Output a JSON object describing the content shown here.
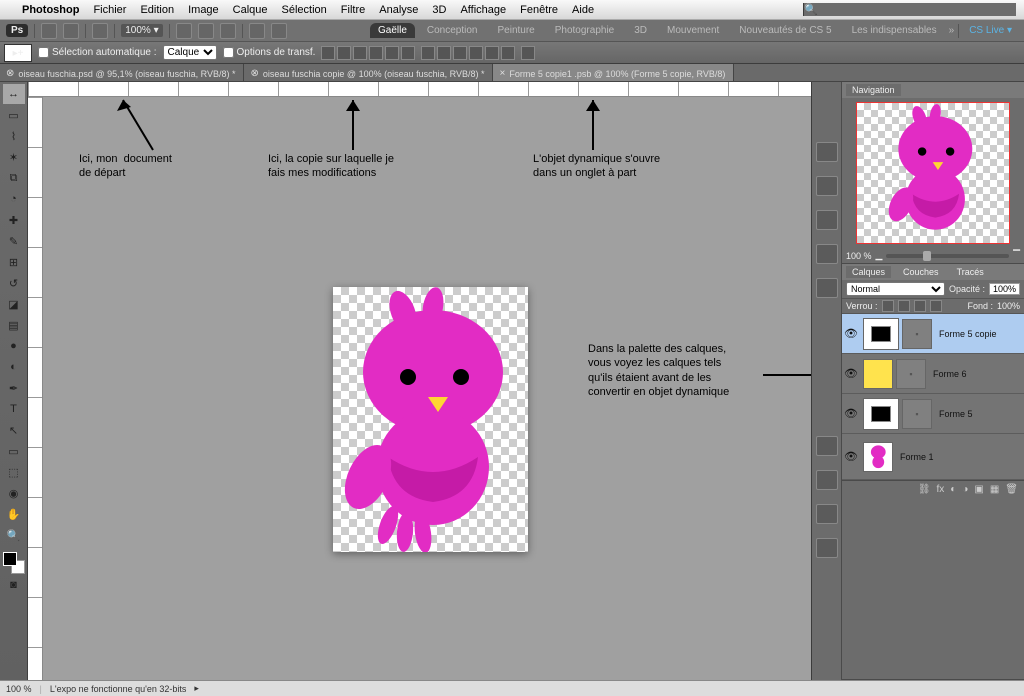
{
  "mac_menu": {
    "app": "Photoshop",
    "items": [
      "Fichier",
      "Edition",
      "Image",
      "Calque",
      "Sélection",
      "Filtre",
      "Analyse",
      "3D",
      "Affichage",
      "Fenêtre",
      "Aide"
    ]
  },
  "appbar": {
    "zoom": "100% ▾",
    "workspaces": [
      "Gaëlle",
      "Conception",
      "Peinture",
      "Photographie",
      "3D",
      "Mouvement",
      "Nouveautés de CS 5",
      "Les indispensables"
    ],
    "active_ws": 0,
    "cslive": "CS Live ▾"
  },
  "options": {
    "auto_select": "Sélection automatique :",
    "layer_select": "Calque",
    "transform": "Options de transf.",
    "tool_icon": "▸+"
  },
  "doc_tabs": [
    "oiseau fuschia.psd @ 95,1% (oiseau fuschia, RVB/8) *",
    "oiseau fuschia copie @ 100% (oiseau fuschia, RVB/8) *",
    "Forme 5 copie1 .psb @ 100% (Forme 5 copie, RVB/8)"
  ],
  "active_tab": 2,
  "annotations": {
    "a1": "Ici, mon  document\nde départ",
    "a2": "Ici, la copie sur laquelle je\nfais mes modifications",
    "a3": "L'objet dynamique s'ouvre\ndans un onglet à part",
    "a4": "Dans la palette des calques,\nvous voyez les calques tels\nqu'ils étaient avant de les\nconvertir en objet dynamique"
  },
  "panels": {
    "navigation": {
      "title": "Navigation",
      "zoom": "100 %"
    },
    "layers": {
      "tabs": [
        "Calques",
        "Couches",
        "Tracés"
      ],
      "blend": "Normal",
      "opacity_label": "Opacité :",
      "opacity": "100%",
      "lock_label": "Verrou :",
      "fill_label": "Fond :",
      "fill": "100%",
      "items": [
        {
          "name": "Forme 5 copie",
          "selected": true,
          "has_mask": true,
          "thumb_fill": "#000"
        },
        {
          "name": "Forme 6",
          "selected": false,
          "has_mask": true,
          "thumb_fill": "#ffe34d"
        },
        {
          "name": "Forme 5",
          "selected": false,
          "has_mask": true,
          "thumb_fill": "#000"
        },
        {
          "name": "Forme 1",
          "selected": false,
          "has_mask": false,
          "thumb_fill": "bird"
        }
      ]
    }
  },
  "statusbar": {
    "zoom": "100 %",
    "info": "L'expo ne fonctionne qu'en 32-bits"
  },
  "colors": {
    "bird": "#e22cc4",
    "bird_dark": "#c51ba7",
    "beak": "#ffd633"
  }
}
